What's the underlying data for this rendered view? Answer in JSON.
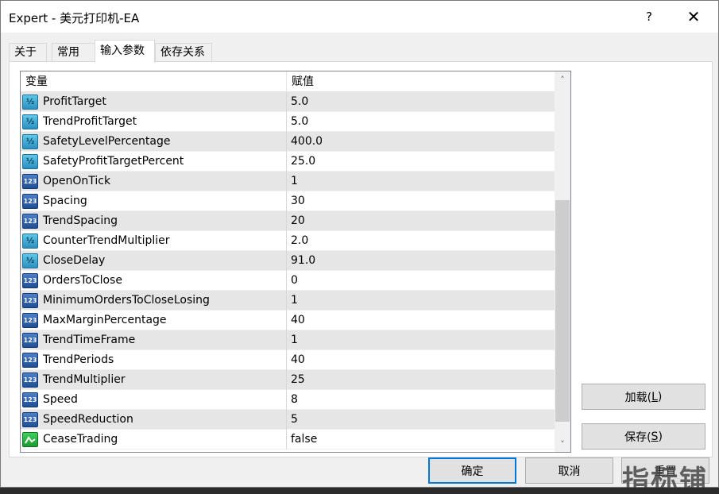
{
  "window": {
    "title": "Expert - 美元打印机-EA",
    "help": "?",
    "close": "✕"
  },
  "tabs": [
    {
      "label": "关于"
    },
    {
      "label": "常用"
    },
    {
      "label": "输入参数"
    },
    {
      "label": "依存关系"
    }
  ],
  "grid": {
    "header": {
      "variable": "变量",
      "value": "赋值"
    },
    "rows": [
      {
        "name": "ProfitTarget",
        "value": "5.0",
        "icon": "double-type-icon"
      },
      {
        "name": "TrendProfitTarget",
        "value": "5.0",
        "icon": "double-type-icon"
      },
      {
        "name": "SafetyLevelPercentage",
        "value": "400.0",
        "icon": "double-type-icon"
      },
      {
        "name": "SafetyProfitTargetPercent",
        "value": "25.0",
        "icon": "double-type-icon"
      },
      {
        "name": "OpenOnTick",
        "value": "1",
        "icon": "integer-type-icon"
      },
      {
        "name": "Spacing",
        "value": "30",
        "icon": "integer-type-icon"
      },
      {
        "name": "TrendSpacing",
        "value": "20",
        "icon": "integer-type-icon"
      },
      {
        "name": "CounterTrendMultiplier",
        "value": "2.0",
        "icon": "double-type-icon"
      },
      {
        "name": "CloseDelay",
        "value": "91.0",
        "icon": "double-type-icon"
      },
      {
        "name": "OrdersToClose",
        "value": "0",
        "icon": "integer-type-icon"
      },
      {
        "name": "MinimumOrdersToCloseLosing",
        "value": "1",
        "icon": "integer-type-icon"
      },
      {
        "name": "MaxMarginPercentage",
        "value": "40",
        "icon": "integer-type-icon"
      },
      {
        "name": "TrendTimeFrame",
        "value": "1",
        "icon": "integer-type-icon"
      },
      {
        "name": "TrendPeriods",
        "value": "40",
        "icon": "integer-type-icon"
      },
      {
        "name": "TrendMultiplier",
        "value": "25",
        "icon": "integer-type-icon"
      },
      {
        "name": "Speed",
        "value": "8",
        "icon": "integer-type-icon"
      },
      {
        "name": "SpeedReduction",
        "value": "5",
        "icon": "integer-type-icon"
      },
      {
        "name": "CeaseTrading",
        "value": "false",
        "icon": "boolean-type-icon"
      }
    ],
    "icon_glyphs": {
      "double": "½",
      "int": "123"
    }
  },
  "buttons": {
    "load": {
      "text": "加载(",
      "key": "L",
      "end": ")"
    },
    "save": {
      "text": "保存(",
      "key": "S",
      "end": ")"
    },
    "ok": "确定",
    "cancel": "取消",
    "reset": "重置"
  },
  "watermark": "指标铺"
}
